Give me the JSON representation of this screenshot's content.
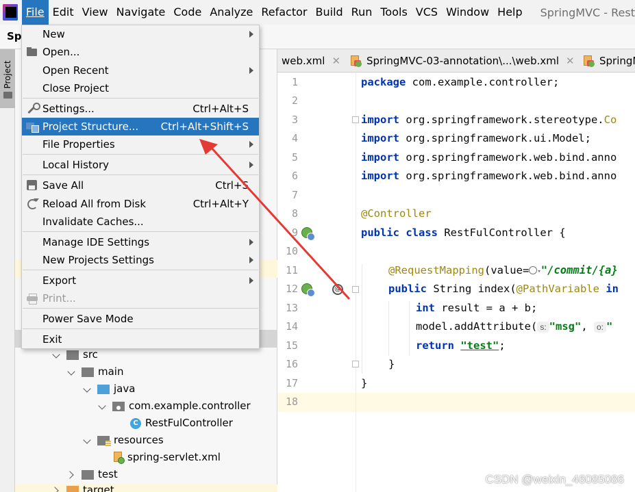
{
  "menubar": {
    "items": [
      "File",
      "Edit",
      "View",
      "Navigate",
      "Code",
      "Analyze",
      "Refactor",
      "Build",
      "Run",
      "Tools",
      "VCS",
      "Window",
      "Help"
    ],
    "active_index": 0,
    "window_title": "SpringMVC - Rest"
  },
  "navbar": {
    "project_label": "Spr"
  },
  "left_strip": {
    "project_tab_label": "Project"
  },
  "file_menu": {
    "items": [
      {
        "label": "New",
        "shortcut": "",
        "submenu": true
      },
      {
        "label": "Open...",
        "shortcut": "",
        "submenu": false,
        "icon": "folder-open-icon"
      },
      {
        "label": "Open Recent",
        "shortcut": "",
        "submenu": true
      },
      {
        "label": "Close Project",
        "shortcut": "",
        "submenu": false
      },
      {
        "label": "Settings...",
        "shortcut": "Ctrl+Alt+S",
        "submenu": false,
        "icon": "wrench-icon"
      },
      {
        "label": "Project Structure...",
        "shortcut": "Ctrl+Alt+Shift+S",
        "submenu": false,
        "icon": "project-structure-icon",
        "selected": true
      },
      {
        "label": "File Properties",
        "shortcut": "",
        "submenu": true
      },
      {
        "label": "Local History",
        "shortcut": "",
        "submenu": true
      },
      {
        "label": "Save All",
        "shortcut": "Ctrl+S",
        "submenu": false,
        "icon": "save-icon"
      },
      {
        "label": "Reload All from Disk",
        "shortcut": "Ctrl+Alt+Y",
        "submenu": false,
        "icon": "reload-icon"
      },
      {
        "label": "Invalidate Caches...",
        "shortcut": "",
        "submenu": false
      },
      {
        "label": "Manage IDE Settings",
        "shortcut": "",
        "submenu": true
      },
      {
        "label": "New Projects Settings",
        "shortcut": "",
        "submenu": true
      },
      {
        "label": "Export",
        "shortcut": "",
        "submenu": true
      },
      {
        "label": "Print...",
        "shortcut": "",
        "submenu": false,
        "icon": "printer-icon",
        "disabled": true
      },
      {
        "label": "Power Save Mode",
        "shortcut": "",
        "submenu": false
      },
      {
        "label": "Exit",
        "shortcut": "",
        "submenu": false
      }
    ]
  },
  "project_tree": {
    "rows": [
      {
        "label": "src",
        "type": "folder"
      },
      {
        "label": "main",
        "type": "folder"
      },
      {
        "label": "java",
        "type": "source-folder"
      },
      {
        "label": "com.example.controller",
        "type": "package"
      },
      {
        "label": "RestFulController",
        "type": "class"
      },
      {
        "label": "resources",
        "type": "resources-folder"
      },
      {
        "label": "spring-servlet.xml",
        "type": "xml-file"
      },
      {
        "label": "test",
        "type": "folder"
      },
      {
        "label": "target",
        "type": "folder"
      }
    ]
  },
  "editor_tabs": [
    {
      "label": "web.xml"
    },
    {
      "label": "SpringMVC-03-annotation\\...\\web.xml"
    },
    {
      "label": "SpringM"
    }
  ],
  "editor": {
    "line_numbers": [
      "1",
      "2",
      "3",
      "4",
      "5",
      "6",
      "7",
      "8",
      "9",
      "10",
      "11",
      "12",
      "13",
      "14",
      "15",
      "16",
      "17",
      "18"
    ],
    "code": {
      "l1_kw": "package",
      "l1_rest": " com.example.controller;",
      "l3_kw": "import",
      "l3_rest": " org.springframework.stereotype.",
      "l3_tail": "Co",
      "l4_kw": "import",
      "l4_rest": " org.springframework.ui.Model;",
      "l5_kw": "import",
      "l5_rest": " org.springframework.web.bind.anno",
      "l6_kw": "import",
      "l6_rest": " org.springframework.web.bind.anno",
      "l8_ann": "@Controller",
      "l9_kw1": "public",
      "l9_kw2": "class",
      "l9_rest": " RestFulController {",
      "l11_ann": "@RequestMapping",
      "l11_mid": "(value=",
      "l11_str": "\"/commit/{a}",
      "l12_kw": "public",
      "l12_mid": " String index(",
      "l12_ann": "@PathVariable",
      "l12_tail": " in",
      "l13_kw": "int",
      "l13_rest": " result = a + b;",
      "l14_pre": "model.addAttribute(",
      "l14_hint1": "s:",
      "l14_str": "\"msg\"",
      "l14_comma": ", ",
      "l14_hint2": "o:",
      "l14_str2": "\"",
      "l15_kw": "return",
      "l15_str": "\"test\"",
      "l15_end": ";",
      "l16": "}",
      "l17": "}"
    },
    "at_symbol": "@"
  },
  "watermark": "CSDN @weixin_46085086",
  "colors": {
    "selection": "#2675bf",
    "keyword": "#0033b3",
    "annotation": "#9e880d",
    "string": "#067d17",
    "arrow": "#e53935"
  }
}
